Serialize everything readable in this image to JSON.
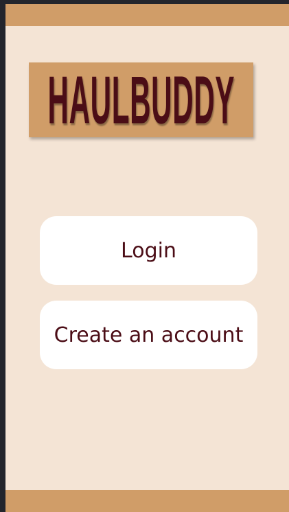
{
  "app": {
    "logo_text": "HAULBUDDY"
  },
  "buttons": {
    "login_label": "Login",
    "create_account_label": "Create an account"
  },
  "colors": {
    "brand_tan": "#d09d68",
    "background_cream": "#f4e4d5",
    "text_maroon": "#4b0d16",
    "button_white": "#ffffff"
  }
}
